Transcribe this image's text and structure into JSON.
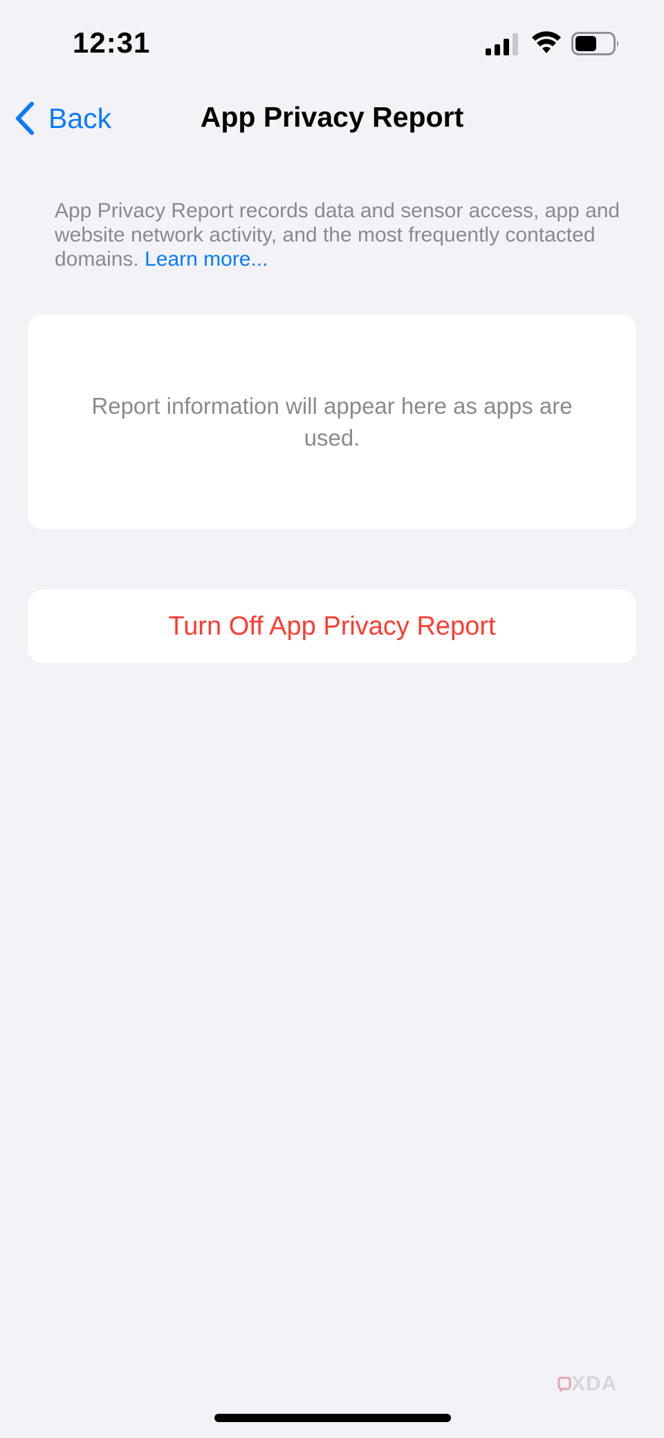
{
  "status_bar": {
    "time": "12:31",
    "icons": [
      "cellular-signal-icon",
      "wifi-icon",
      "battery-icon"
    ]
  },
  "nav": {
    "back_label": "Back",
    "title": "App Privacy Report"
  },
  "description": {
    "text": "App Privacy Report records data and sensor access, app and website network activity, and the most frequently contacted domains. ",
    "link_label": "Learn more..."
  },
  "report": {
    "empty_message": "Report information will appear here as apps are used."
  },
  "actions": {
    "turn_off_label": "Turn Off App Privacy Report"
  },
  "watermark": {
    "brand": "XDA"
  },
  "colors": {
    "background": "#f2f2f7",
    "accent": "#0a7aff",
    "destructive": "#ff3b30",
    "secondary_text": "#8a8a8e"
  }
}
